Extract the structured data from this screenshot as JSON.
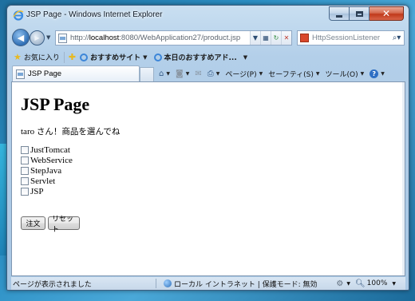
{
  "window": {
    "title": "JSP Page - Windows Internet Explorer"
  },
  "address_bar": {
    "url_scheme": "http://",
    "url_host": "localhost",
    "url_rest": ":8080/WebApplication27/product.jsp"
  },
  "search": {
    "placeholder": "HttpSessionListener"
  },
  "favorites_bar": {
    "favorites_label": "お気に入り",
    "suggested_sites": "おすすめサイト",
    "web_slice": "本日のおすすめアド..."
  },
  "tab": {
    "label": "JSP Page"
  },
  "command_bar": {
    "page": "ページ(P)",
    "safety": "セーフティ(S)",
    "tools": "ツール(O)"
  },
  "page": {
    "heading": "JSP Page",
    "user": "taro",
    "greeting": "さん！商品を選んでね",
    "options": [
      {
        "label": "JustTomcat",
        "checked": false
      },
      {
        "label": "WebService",
        "checked": false
      },
      {
        "label": "StepJava",
        "checked": false
      },
      {
        "label": "Servlet",
        "checked": false
      },
      {
        "label": "JSP",
        "checked": false
      }
    ],
    "order_button": "注文",
    "reset_button": "リセット"
  },
  "status_bar": {
    "message": "ページが表示されました",
    "zone": "ローカル イントラネット | 保護モード: 無効",
    "zoom": "100%"
  },
  "colors": {
    "titlebar": "#b3cfe9",
    "close_button": "#c0391b",
    "link_blue": "#2e6fc4"
  }
}
